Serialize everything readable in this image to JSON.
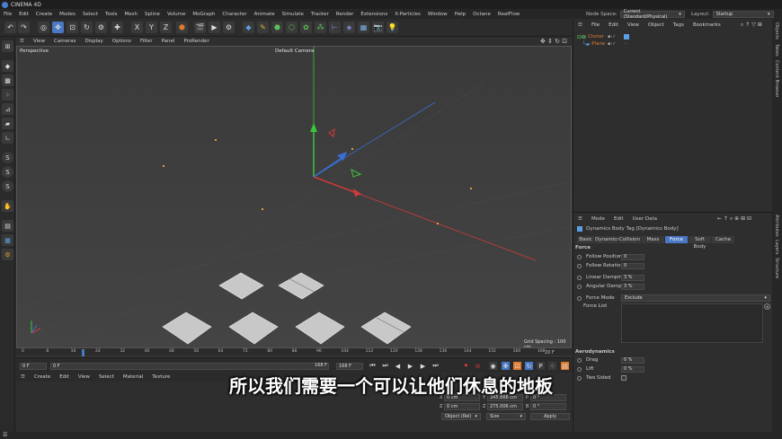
{
  "app": {
    "title": "CINEMA 4D"
  },
  "menubar": {
    "items": [
      "File",
      "Edit",
      "Create",
      "Modes",
      "Select",
      "Tools",
      "Mesh",
      "Spline",
      "Volume",
      "MoGraph",
      "Character",
      "Animate",
      "Simulate",
      "Tracker",
      "Render",
      "Extensions",
      "X-Particles",
      "Window",
      "Help",
      "Octane",
      "RealFlow"
    ],
    "node_space_label": "Node Space:",
    "node_space_value": "Current (Standard/Physical)",
    "layout_label": "Layout:",
    "layout_value": "Startup"
  },
  "viewport": {
    "menu": [
      "View",
      "Cameras",
      "Display",
      "Options",
      "Filter",
      "Panel",
      "ProRender"
    ],
    "label": "Perspective",
    "camera": "Default Camera",
    "grid_spacing": "Grid Spacing : 100 cm"
  },
  "timeline": {
    "ticks": [
      "0",
      "8",
      "16",
      "24",
      "32",
      "40",
      "48",
      "56",
      "64",
      "72",
      "80",
      "88",
      "96",
      "104",
      "112",
      "120",
      "128",
      "136",
      "144",
      "152",
      "160",
      "168"
    ],
    "end_frame_label": "20 F",
    "current_frame": "0 F",
    "min_field": "0 F",
    "max_field": "168 F",
    "end_field": "168 F"
  },
  "material_menu": [
    "Create",
    "Edit",
    "View",
    "Select",
    "Material",
    "Texture"
  ],
  "coords": {
    "x_pos": "0 cm",
    "y_pos": "345.866 cm",
    "z_pos": "0 cm",
    "x_size": "0 cm",
    "y_size": "275.006 cm",
    "z_size": "0 cm",
    "h": "0 °",
    "p": "0 °",
    "b": "0 °",
    "mode": "Object (Rel)",
    "size_mode": "Size",
    "apply": "Apply"
  },
  "object_manager": {
    "menu": [
      "File",
      "Edit",
      "View",
      "Object",
      "Tags",
      "Bookmarks"
    ],
    "objects": [
      {
        "name": "Cloner",
        "color": "#e07a2e"
      },
      {
        "name": "Plane",
        "color": "#e07a2e"
      }
    ]
  },
  "attributes": {
    "menu": [
      "Mode",
      "Edit",
      "User Data"
    ],
    "header": "Dynamics Body Tag [Dynamics Body]",
    "tabs": [
      "Basic",
      "Dynamics",
      "Collision",
      "Mass",
      "Force",
      "Soft Body",
      "Cache"
    ],
    "active_tab": "Force",
    "section_force": "Force",
    "params": [
      {
        "label": "Follow Position",
        "value": "0"
      },
      {
        "label": "Follow Rotation",
        "value": "0"
      },
      {
        "label": "Linear Damping",
        "value": "3 %"
      },
      {
        "label": "Angular Damping",
        "value": "3 %"
      }
    ],
    "force_mode_label": "Force Mode",
    "force_mode_value": "Exclude",
    "force_list_label": "Force List",
    "section_aero": "Aerodynamics",
    "aero_params": [
      {
        "label": "Drag",
        "value": "0 %"
      },
      {
        "label": "Lift",
        "value": "0 %"
      }
    ],
    "two_sided_label": "Two Sided"
  },
  "side_tabs": [
    "Objects",
    "Takes",
    "Content Browser",
    "Attributes",
    "Layers",
    "Structure"
  ],
  "subtitle": "所以我们需要一个可以让他们休息的地板",
  "colors": {
    "accent": "#4a78c4",
    "x_axis": "#d43a3a",
    "y_axis": "#3cc43c",
    "z_axis": "#3a6fd4"
  }
}
